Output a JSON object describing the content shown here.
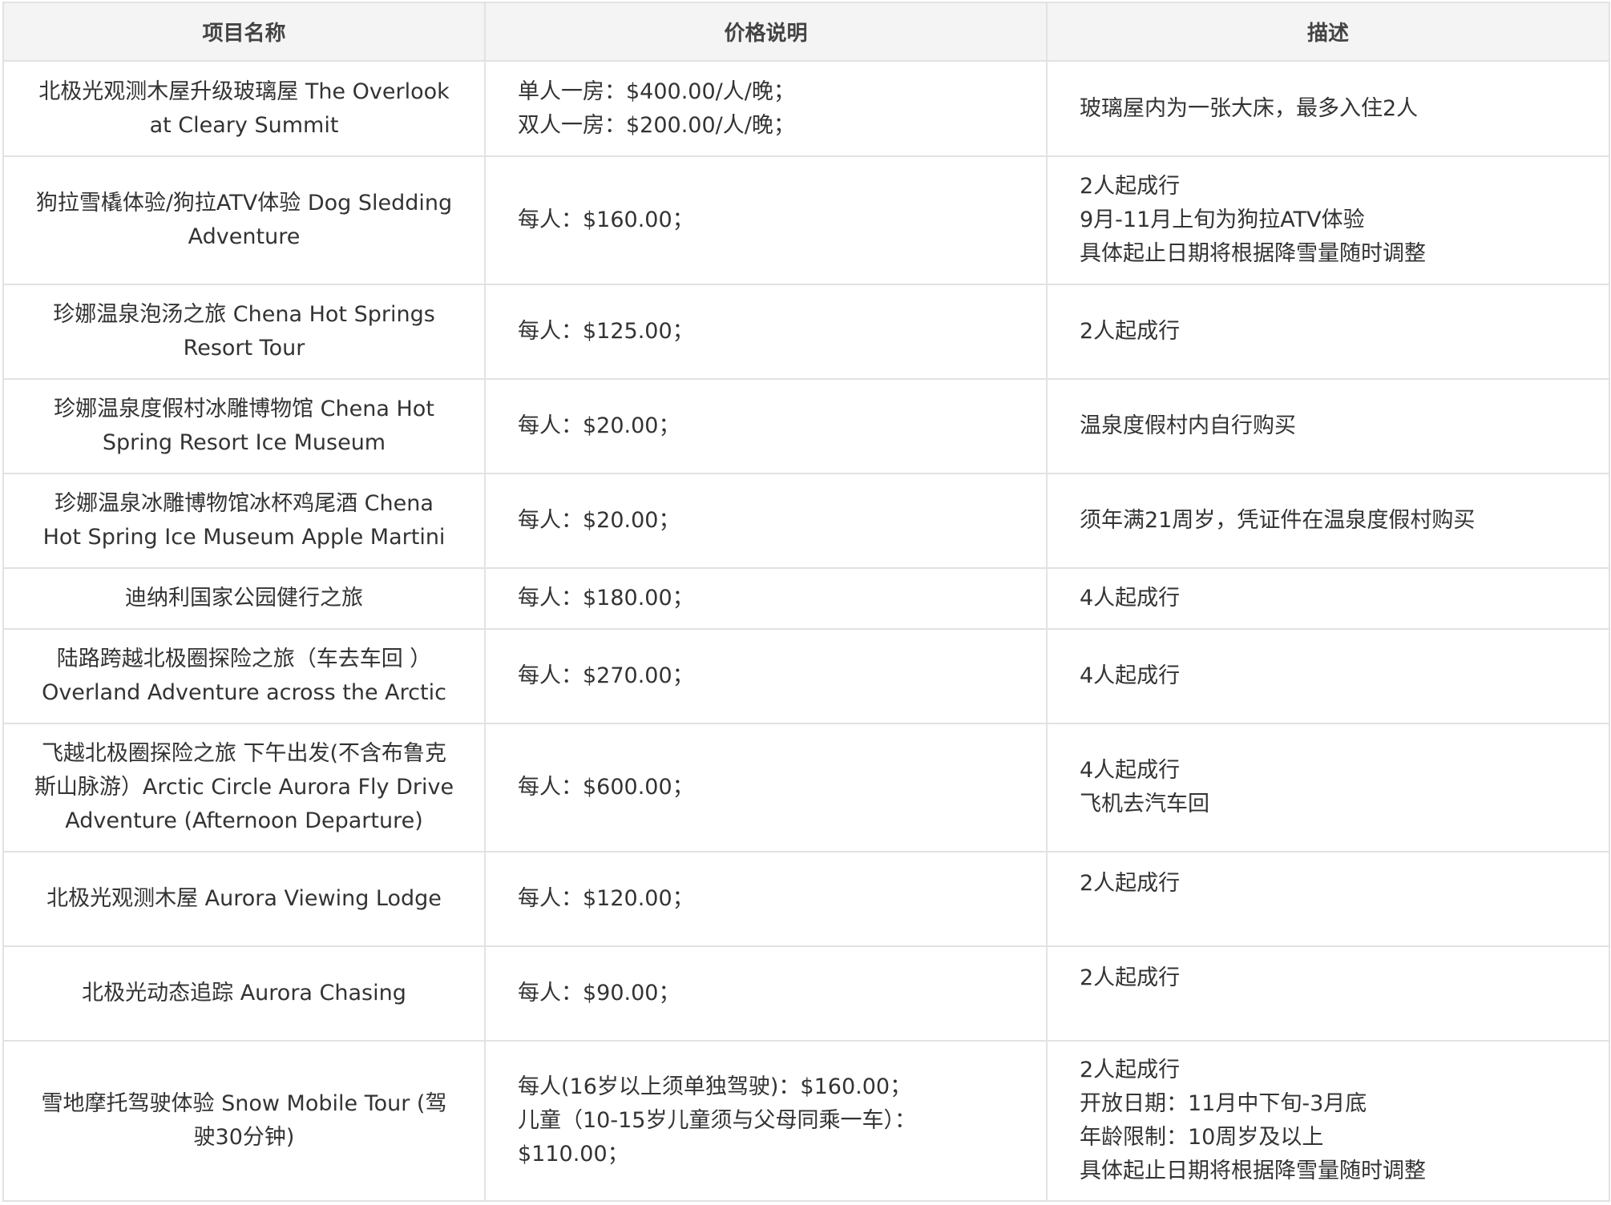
{
  "headers": [
    "项目名称",
    "价格说明",
    "描述"
  ],
  "rows": [
    {
      "name": "北极光观测木屋升级玻璃屋 The Overlook at Cleary Summit",
      "price": [
        "单人一房：$400.00/人/晚；",
        "双人一房：$200.00/人/晚；"
      ],
      "desc": [
        "玻璃屋内为一张大床，最多入住2人"
      ]
    },
    {
      "name": "狗拉雪橇体验/狗拉ATV体验 Dog Sledding Adventure",
      "price": [
        "每人：$160.00；"
      ],
      "desc": [
        "2人起成行",
        "9月-11月上旬为狗拉ATV体验",
        "具体起止日期将根据降雪量随时调整"
      ]
    },
    {
      "name": "珍娜温泉泡汤之旅 Chena Hot Springs Resort Tour",
      "price": [
        "每人：$125.00；"
      ],
      "desc": [
        "2人起成行"
      ]
    },
    {
      "name": "珍娜温泉度假村冰雕博物馆 Chena Hot Spring Resort Ice Museum",
      "price": [
        "每人：$20.00；"
      ],
      "desc": [
        "温泉度假村内自行购买"
      ]
    },
    {
      "name": "珍娜温泉冰雕博物馆冰杯鸡尾酒 Chena Hot Spring Ice Museum Apple Martini",
      "price": [
        "每人：$20.00；"
      ],
      "desc": [
        "须年满21周岁，凭证件在温泉度假村购买"
      ]
    },
    {
      "name": "迪纳利国家公园健行之旅",
      "price": [
        "每人：$180.00；"
      ],
      "desc": [
        "4人起成行"
      ]
    },
    {
      "name": "陆路跨越北极圈探险之旅（车去车回 ）Overland Adventure across the Arctic",
      "price": [
        "每人：$270.00；"
      ],
      "desc": [
        "4人起成行"
      ]
    },
    {
      "name": "飞越北极圈探险之旅 下午出发(不含布鲁克斯山脉游）Arctic Circle Aurora Fly Drive Adventure (Afternoon Departure)",
      "price": [
        "每人：$600.00；"
      ],
      "desc": [
        "4人起成行",
        "飞机去汽车回"
      ]
    },
    {
      "name": "北极光观测木屋 Aurora Viewing Lodge",
      "price": [
        "每人：$120.00；"
      ],
      "desc": [
        "2人起成行"
      ]
    },
    {
      "name": "北极光动态追踪 Aurora Chasing",
      "price": [
        "每人：$90.00；"
      ],
      "desc": [
        "2人起成行"
      ]
    },
    {
      "name": "雪地摩托驾驶体验 Snow Mobile Tour (驾驶30分钟)",
      "price": [
        "每人(16岁以上须单独驾驶)：$160.00；",
        "儿童（10-15岁儿童须与父母同乘一车）：",
        "$110.00；"
      ],
      "desc": [
        "2人起成行",
        "开放日期：11月中下旬-3月底",
        "年龄限制：10周岁及以上",
        "具体起止日期将根据降雪量随时调整"
      ]
    }
  ]
}
